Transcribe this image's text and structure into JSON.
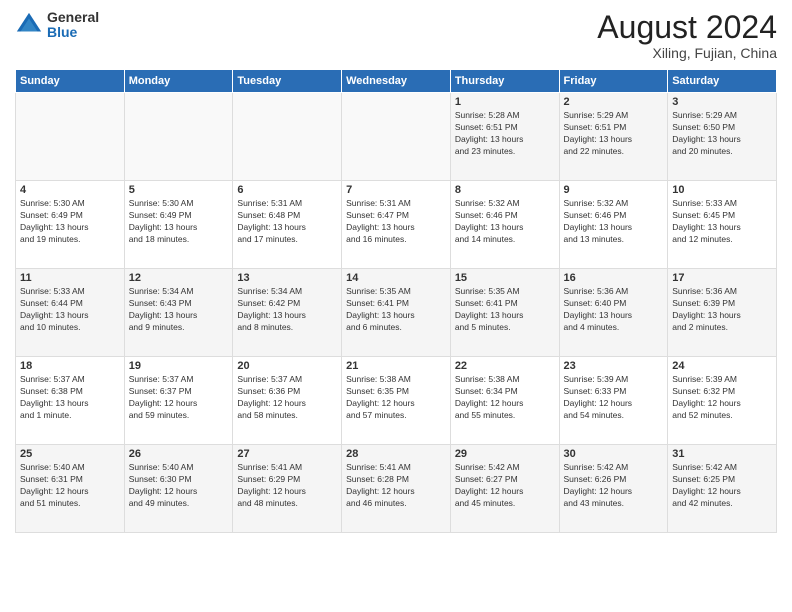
{
  "logo": {
    "general": "General",
    "blue": "Blue"
  },
  "title": "August 2024",
  "location": "Xiling, Fujian, China",
  "weekdays": [
    "Sunday",
    "Monday",
    "Tuesday",
    "Wednesday",
    "Thursday",
    "Friday",
    "Saturday"
  ],
  "weeks": [
    [
      {
        "day": "",
        "info": ""
      },
      {
        "day": "",
        "info": ""
      },
      {
        "day": "",
        "info": ""
      },
      {
        "day": "",
        "info": ""
      },
      {
        "day": "1",
        "info": "Sunrise: 5:28 AM\nSunset: 6:51 PM\nDaylight: 13 hours\nand 23 minutes."
      },
      {
        "day": "2",
        "info": "Sunrise: 5:29 AM\nSunset: 6:51 PM\nDaylight: 13 hours\nand 22 minutes."
      },
      {
        "day": "3",
        "info": "Sunrise: 5:29 AM\nSunset: 6:50 PM\nDaylight: 13 hours\nand 20 minutes."
      }
    ],
    [
      {
        "day": "4",
        "info": "Sunrise: 5:30 AM\nSunset: 6:49 PM\nDaylight: 13 hours\nand 19 minutes."
      },
      {
        "day": "5",
        "info": "Sunrise: 5:30 AM\nSunset: 6:49 PM\nDaylight: 13 hours\nand 18 minutes."
      },
      {
        "day": "6",
        "info": "Sunrise: 5:31 AM\nSunset: 6:48 PM\nDaylight: 13 hours\nand 17 minutes."
      },
      {
        "day": "7",
        "info": "Sunrise: 5:31 AM\nSunset: 6:47 PM\nDaylight: 13 hours\nand 16 minutes."
      },
      {
        "day": "8",
        "info": "Sunrise: 5:32 AM\nSunset: 6:46 PM\nDaylight: 13 hours\nand 14 minutes."
      },
      {
        "day": "9",
        "info": "Sunrise: 5:32 AM\nSunset: 6:46 PM\nDaylight: 13 hours\nand 13 minutes."
      },
      {
        "day": "10",
        "info": "Sunrise: 5:33 AM\nSunset: 6:45 PM\nDaylight: 13 hours\nand 12 minutes."
      }
    ],
    [
      {
        "day": "11",
        "info": "Sunrise: 5:33 AM\nSunset: 6:44 PM\nDaylight: 13 hours\nand 10 minutes."
      },
      {
        "day": "12",
        "info": "Sunrise: 5:34 AM\nSunset: 6:43 PM\nDaylight: 13 hours\nand 9 minutes."
      },
      {
        "day": "13",
        "info": "Sunrise: 5:34 AM\nSunset: 6:42 PM\nDaylight: 13 hours\nand 8 minutes."
      },
      {
        "day": "14",
        "info": "Sunrise: 5:35 AM\nSunset: 6:41 PM\nDaylight: 13 hours\nand 6 minutes."
      },
      {
        "day": "15",
        "info": "Sunrise: 5:35 AM\nSunset: 6:41 PM\nDaylight: 13 hours\nand 5 minutes."
      },
      {
        "day": "16",
        "info": "Sunrise: 5:36 AM\nSunset: 6:40 PM\nDaylight: 13 hours\nand 4 minutes."
      },
      {
        "day": "17",
        "info": "Sunrise: 5:36 AM\nSunset: 6:39 PM\nDaylight: 13 hours\nand 2 minutes."
      }
    ],
    [
      {
        "day": "18",
        "info": "Sunrise: 5:37 AM\nSunset: 6:38 PM\nDaylight: 13 hours\nand 1 minute."
      },
      {
        "day": "19",
        "info": "Sunrise: 5:37 AM\nSunset: 6:37 PM\nDaylight: 12 hours\nand 59 minutes."
      },
      {
        "day": "20",
        "info": "Sunrise: 5:37 AM\nSunset: 6:36 PM\nDaylight: 12 hours\nand 58 minutes."
      },
      {
        "day": "21",
        "info": "Sunrise: 5:38 AM\nSunset: 6:35 PM\nDaylight: 12 hours\nand 57 minutes."
      },
      {
        "day": "22",
        "info": "Sunrise: 5:38 AM\nSunset: 6:34 PM\nDaylight: 12 hours\nand 55 minutes."
      },
      {
        "day": "23",
        "info": "Sunrise: 5:39 AM\nSunset: 6:33 PM\nDaylight: 12 hours\nand 54 minutes."
      },
      {
        "day": "24",
        "info": "Sunrise: 5:39 AM\nSunset: 6:32 PM\nDaylight: 12 hours\nand 52 minutes."
      }
    ],
    [
      {
        "day": "25",
        "info": "Sunrise: 5:40 AM\nSunset: 6:31 PM\nDaylight: 12 hours\nand 51 minutes."
      },
      {
        "day": "26",
        "info": "Sunrise: 5:40 AM\nSunset: 6:30 PM\nDaylight: 12 hours\nand 49 minutes."
      },
      {
        "day": "27",
        "info": "Sunrise: 5:41 AM\nSunset: 6:29 PM\nDaylight: 12 hours\nand 48 minutes."
      },
      {
        "day": "28",
        "info": "Sunrise: 5:41 AM\nSunset: 6:28 PM\nDaylight: 12 hours\nand 46 minutes."
      },
      {
        "day": "29",
        "info": "Sunrise: 5:42 AM\nSunset: 6:27 PM\nDaylight: 12 hours\nand 45 minutes."
      },
      {
        "day": "30",
        "info": "Sunrise: 5:42 AM\nSunset: 6:26 PM\nDaylight: 12 hours\nand 43 minutes."
      },
      {
        "day": "31",
        "info": "Sunrise: 5:42 AM\nSunset: 6:25 PM\nDaylight: 12 hours\nand 42 minutes."
      }
    ]
  ]
}
